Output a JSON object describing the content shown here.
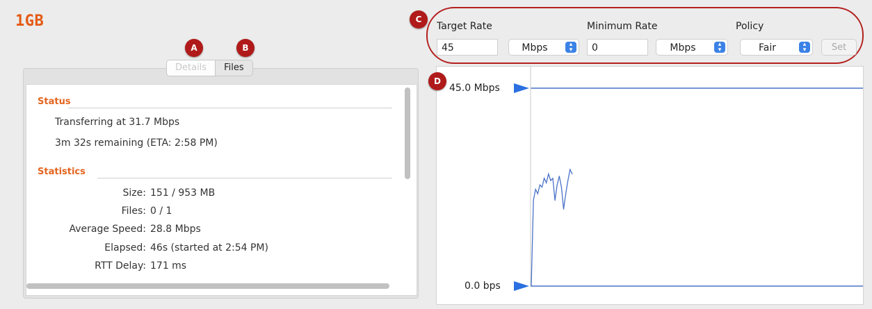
{
  "title": "1GB",
  "markers": {
    "a": "A",
    "b": "B",
    "c": "C",
    "d": "D"
  },
  "tabs": {
    "details": "Details",
    "files": "Files"
  },
  "status": {
    "heading": "Status",
    "line1": "Transferring at 31.7 Mbps",
    "line2": "3m 32s remaining (ETA: 2:58 PM)"
  },
  "statistics": {
    "heading": "Statistics",
    "rows": [
      {
        "label": "Size:",
        "value": "151 / 953 MB"
      },
      {
        "label": "Files:",
        "value": "0 / 1"
      },
      {
        "label": "Average Speed:",
        "value": "28.8 Mbps"
      },
      {
        "label": "Elapsed:",
        "value": "46s (started at 2:54 PM)"
      },
      {
        "label": "RTT Delay:",
        "value": "171 ms"
      }
    ]
  },
  "controls": {
    "target_rate_label": "Target Rate",
    "target_rate_value": "45",
    "target_unit": "Mbps",
    "minimum_rate_label": "Minimum Rate",
    "minimum_rate_value": "0",
    "minimum_unit": "Mbps",
    "policy_label": "Policy",
    "policy_value": "Fair",
    "set_label": "Set"
  },
  "chart": {
    "top_label": "45.0 Mbps",
    "bottom_label": "0.0 bps"
  },
  "chart_data": {
    "type": "line",
    "ylim": [
      0,
      45
    ],
    "series": [
      {
        "values": [
          0,
          19.5,
          22.0,
          21.0,
          23.0,
          22.5,
          24.5,
          23.5,
          25.5,
          24.0,
          24.5,
          19.5,
          23.0,
          25.0,
          22.5,
          17.5,
          21.0,
          24.0,
          26.5,
          25.5
        ]
      }
    ]
  },
  "colors": {
    "accent": "#e45a14",
    "marker": "#b01a1a",
    "line": "#4a72c8",
    "arrow": "#2b6fe0"
  }
}
